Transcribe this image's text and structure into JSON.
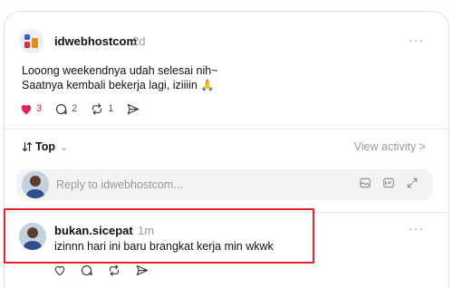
{
  "post": {
    "username": "idwebhostcom",
    "time": "2d",
    "more": "···",
    "text_lines": [
      "Looong weekendnya udah selesai nih~",
      "Saatnya kembali bekerja lagi, iziiiin 🙏"
    ],
    "likes": "3",
    "comments": "2",
    "reposts": "1",
    "brand_colors": [
      "#3b5bdb",
      "#e03131",
      "#f08c00"
    ]
  },
  "sort": {
    "label": "Top",
    "chevron": "⌄",
    "view_activity": "View activity >"
  },
  "reply": {
    "placeholder": "Reply to idwebhostcom...",
    "icons": [
      "image-icon",
      "gif-icon",
      "expand-icon"
    ]
  },
  "comment": {
    "username": "bukan.sicepat",
    "time": "1m",
    "more": "···",
    "text": "izinnn hari ini baru brangkat kerja min wkwk"
  },
  "colors": {
    "like": "#e0245e",
    "highlight": "#e0242c",
    "muted": "#999999"
  }
}
